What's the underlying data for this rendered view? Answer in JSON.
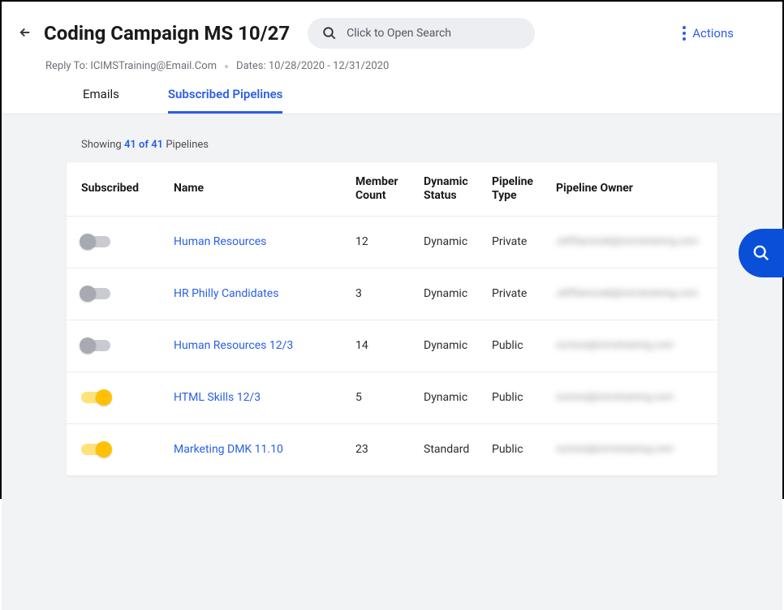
{
  "header": {
    "title": "Coding Campaign MS 10/27",
    "search_placeholder": "Click to Open Search",
    "actions_label": "Actions",
    "reply_to_label": "Reply To: ICIMSTraining@Email.Com",
    "dates_label": "Dates: 10/28/2020 - 12/31/2020"
  },
  "tabs": {
    "emails": "Emails",
    "pipelines": "Subscribed Pipelines"
  },
  "showing": {
    "prefix": "Showing",
    "count": "41 of 41",
    "suffix": "Pipelines"
  },
  "columns": {
    "subscribed": "Subscribed",
    "name": "Name",
    "member_count": "Member Count",
    "dynamic_status": "Dynamic Status",
    "pipeline_type": "Pipeline Type",
    "owner": "Pipeline Owner"
  },
  "rows": [
    {
      "subscribed": false,
      "name": "Human Resources",
      "count": "12",
      "status": "Dynamic",
      "type": "Private",
      "owner": "JeffSamorak@icimstraining.com"
    },
    {
      "subscribed": false,
      "name": "HR Philly Candidates",
      "count": "3",
      "status": "Dynamic",
      "type": "Private",
      "owner": "JeffSamorak@icimstraining.com"
    },
    {
      "subscribed": false,
      "name": "Human Resources 12/3",
      "count": "14",
      "status": "Dynamic",
      "type": "Public",
      "owner": "nurture@icimstraining.com"
    },
    {
      "subscribed": true,
      "name": "HTML Skills 12/3",
      "count": "5",
      "status": "Dynamic",
      "type": "Public",
      "owner": "nurture@icimstraining.com"
    },
    {
      "subscribed": true,
      "name": "Marketing DMK 11.10",
      "count": "23",
      "status": "Standard",
      "type": "Public",
      "owner": "nurture@icimstraining.com"
    }
  ]
}
